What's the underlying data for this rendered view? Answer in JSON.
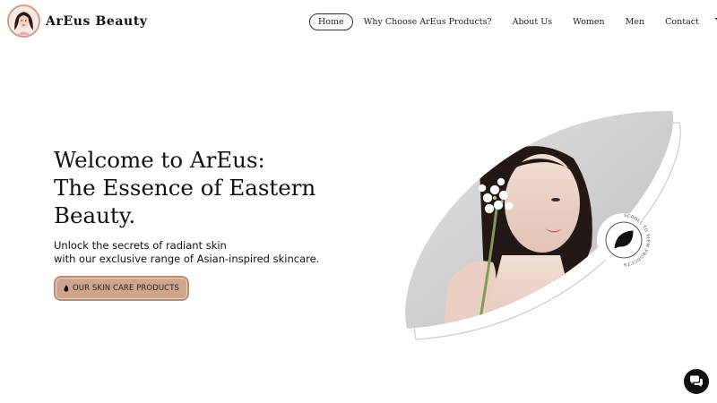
{
  "brand": {
    "name": "ArEus Beauty"
  },
  "nav": {
    "items": [
      "Home",
      "Why Choose ArEus Products?",
      "About Us",
      "Women",
      "Men",
      "Contact"
    ],
    "active": "Home",
    "icons": [
      "cart-icon",
      "user-icon"
    ]
  },
  "hero": {
    "title_lines": [
      "Welcome to ArEus:",
      "The Essence of Eastern",
      "Beauty."
    ],
    "subtitle_lines": [
      "Unlock the secrets of radiant skin",
      "with our exclusive range of Asian-inspired skincare."
    ],
    "cta_label": "OUR SKIN CARE PRODUCTS",
    "scroll_badge_text": "SCROLL TO VIEW PRODUCTS",
    "scroll_badge_icon": "leaf-icon"
  },
  "colors": {
    "accent": "#cfa58e",
    "accent_border": "#b88b74",
    "text": "#111111",
    "background": "#ffffff"
  },
  "chat": {
    "icon": "chat-bubbles-icon"
  }
}
